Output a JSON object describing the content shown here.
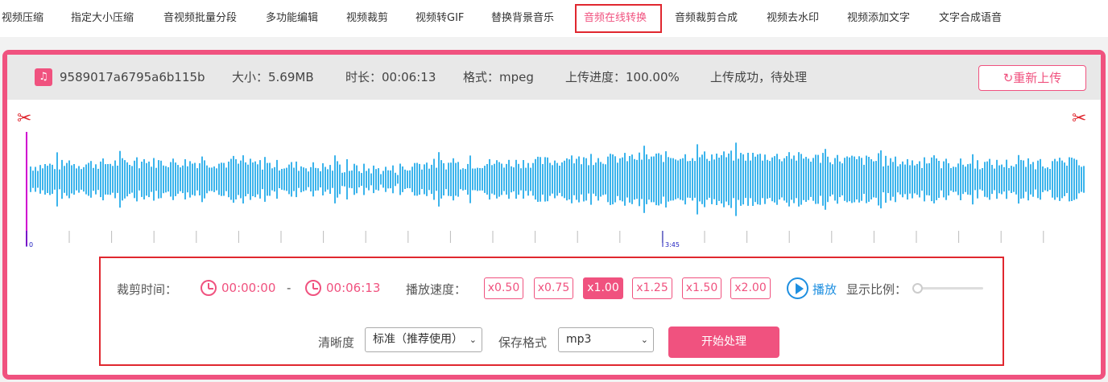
{
  "nav": {
    "items": [
      "视频压缩",
      "指定大小压缩",
      "音视频批量分段",
      "多功能编辑",
      "视频裁剪",
      "视频转GIF",
      "替换背景音乐",
      "音频在线转换",
      "音频裁剪合成",
      "视频去水印",
      "视频添加文字",
      "文字合成语音"
    ],
    "active_index": 7
  },
  "file": {
    "name": "9589017a6795a6b115b...",
    "size": "大小：5.69MB",
    "duration": "时长：00:06:13",
    "format": "格式：mpeg",
    "progress": "上传进度：100.00%",
    "status": "上传成功，待处理",
    "reupload_label": "重新上传"
  },
  "timeline": {
    "start_label": "0",
    "mid_label": "3:45"
  },
  "controls": {
    "trim_label": "裁剪时间：",
    "start_time": "00:00:00",
    "separator": "-",
    "end_time": "00:06:13",
    "speed_label": "播放速度：",
    "speeds": [
      "x0.50",
      "x0.75",
      "x1.00",
      "x1.25",
      "x1.50",
      "x2.00"
    ],
    "active_speed": "x1.00",
    "play_label": "播放",
    "zoom_label": "显示比例：",
    "zoom_value": 0,
    "quality_label": "清晰度",
    "quality_value": "标准（推荐使用）",
    "format_label": "保存格式",
    "format_value": "mp3",
    "start_button": "开始处理"
  },
  "colors": {
    "accent": "#f0527f",
    "wave": "#3bb4ec",
    "highlight_border": "#e0272f",
    "play": "#1e8fe0"
  }
}
